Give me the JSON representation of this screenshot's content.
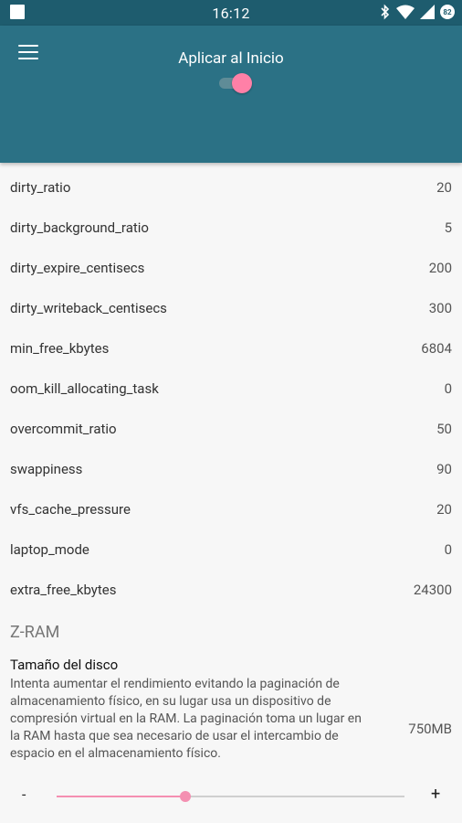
{
  "status_bar": {
    "time": "16:12",
    "battery_level": "82",
    "icons": [
      "notification-square-icon",
      "bluetooth-icon",
      "wifi-icon",
      "signal-icon",
      "battery-icon"
    ]
  },
  "app_bar": {
    "title": "Aplicar al Inicio",
    "toggle_on": true,
    "colors": {
      "status": "#1e5c6e",
      "bar": "#2b7185",
      "accent": "#ff80a7"
    }
  },
  "settings": [
    {
      "name": "dirty_ratio",
      "value": "20"
    },
    {
      "name": "dirty_background_ratio",
      "value": "5"
    },
    {
      "name": "dirty_expire_centisecs",
      "value": "200"
    },
    {
      "name": "dirty_writeback_centisecs",
      "value": "300"
    },
    {
      "name": "min_free_kbytes",
      "value": "6804"
    },
    {
      "name": "oom_kill_allocating_task",
      "value": "0"
    },
    {
      "name": "overcommit_ratio",
      "value": "50"
    },
    {
      "name": "swappiness",
      "value": "90"
    },
    {
      "name": "vfs_cache_pressure",
      "value": "20"
    },
    {
      "name": "laptop_mode",
      "value": "0"
    },
    {
      "name": "extra_free_kbytes",
      "value": "24300"
    }
  ],
  "zram": {
    "section_title": "Z-RAM",
    "disk_title": "Tamaño del disco",
    "description": "Intenta aumentar el rendimiento evitando la paginación de almacenamiento físico, en su lugar usa un dispositivo de compresión virtual en la RAM. La paginación toma un lugar en la RAM hasta que sea necesario de usar el intercambio de espacio en el almacenamiento físico.",
    "size": "750MB",
    "slider_minus": "-",
    "slider_plus": "+",
    "slider_fraction": 0.37
  }
}
